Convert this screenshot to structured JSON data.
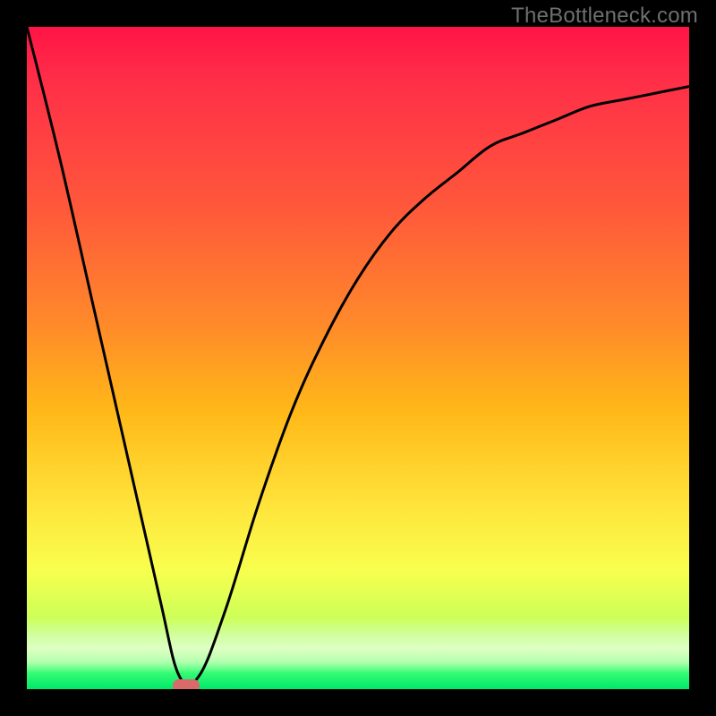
{
  "watermark": "TheBottleneck.com",
  "chart_data": {
    "type": "line",
    "title": "",
    "xlabel": "",
    "ylabel": "",
    "xlim": [
      0,
      100
    ],
    "ylim": [
      0,
      100
    ],
    "grid": false,
    "legend": false,
    "background_gradient": {
      "direction": "vertical",
      "stops": [
        {
          "pos": 0,
          "color": "#ff1446",
          "meaning": "high bottleneck"
        },
        {
          "pos": 50,
          "color": "#ffb818",
          "meaning": "moderate bottleneck"
        },
        {
          "pos": 100,
          "color": "#00e868",
          "meaning": "no bottleneck"
        }
      ]
    },
    "series": [
      {
        "name": "bottleneck-curve",
        "color": "#000000",
        "x": [
          0,
          5,
          10,
          15,
          20,
          23,
          26,
          30,
          35,
          40,
          45,
          50,
          55,
          60,
          65,
          70,
          75,
          80,
          85,
          90,
          95,
          100
        ],
        "y": [
          100,
          80,
          58,
          36,
          14,
          2,
          2,
          12,
          28,
          42,
          53,
          62,
          69,
          74,
          78,
          82,
          84,
          86,
          88,
          89,
          90,
          91
        ]
      }
    ],
    "marker": {
      "name": "optimal-point",
      "x": 24,
      "y": 0.5,
      "color": "#d96a6a",
      "shape": "pill"
    }
  }
}
